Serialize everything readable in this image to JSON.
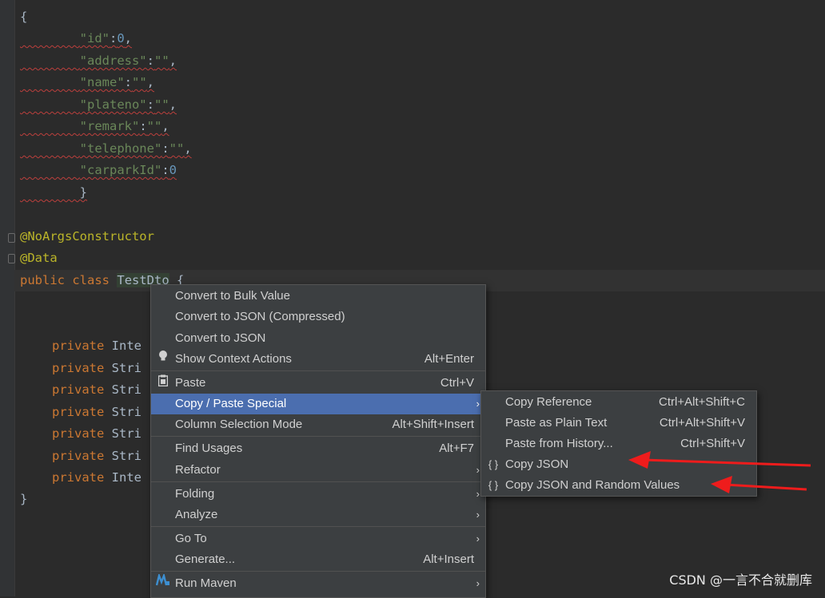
{
  "editor": {
    "lines": [
      {
        "t": "{"
      },
      {
        "k": "        ",
        "s": "\"id\"",
        "p": ":",
        "n": "0",
        "e": ","
      },
      {
        "k": "        ",
        "s": "\"address\"",
        "p": ":",
        "v": "\"\"",
        "e": ","
      },
      {
        "k": "        ",
        "s": "\"name\"",
        "p": ":",
        "v": "\"\"",
        "e": ","
      },
      {
        "k": "        ",
        "s": "\"plateno\"",
        "p": ":",
        "v": "\"\"",
        "e": ","
      },
      {
        "k": "        ",
        "s": "\"remark\"",
        "p": ":",
        "v": "\"\"",
        "e": ","
      },
      {
        "k": "        ",
        "s": "\"telephone\"",
        "p": ":",
        "v": "\"\"",
        "e": ","
      },
      {
        "k": "        ",
        "s": "\"carparkId\"",
        "p": ":",
        "n": "0",
        "e": ""
      },
      {
        "t": "        }"
      }
    ],
    "annotation1": "@NoArgsConstructor",
    "annotation2": "@Data",
    "class_kw1": "public",
    "class_kw2": "class",
    "class_name": "TestDto",
    "class_brace": "{",
    "fields": [
      {
        "kw": "private",
        "type": "Inte"
      },
      {
        "kw": "private",
        "type": "Stri"
      },
      {
        "kw": "private",
        "type": "Stri"
      },
      {
        "kw": "private",
        "type": "Stri"
      },
      {
        "kw": "private",
        "type": "Stri"
      },
      {
        "kw": "private",
        "type": "Stri"
      },
      {
        "kw": "private",
        "type": "Inte"
      }
    ],
    "closing_brace": "}"
  },
  "context_menu": {
    "items": [
      {
        "label": "Convert to Bulk Value",
        "shortcut": "",
        "arrow": ""
      },
      {
        "label": "Convert to JSON (Compressed)",
        "shortcut": "",
        "arrow": ""
      },
      {
        "label": "Convert to JSON",
        "shortcut": "",
        "arrow": ""
      },
      {
        "label": "Show Context Actions",
        "shortcut": "Alt+Enter",
        "arrow": "",
        "icon": "lightbulb-icon"
      },
      {
        "label": "Paste",
        "shortcut": "Ctrl+V",
        "arrow": "",
        "icon": "clipboard-icon"
      },
      {
        "label": "Copy / Paste Special",
        "shortcut": "",
        "arrow": "›"
      },
      {
        "label": "Column Selection Mode",
        "shortcut": "Alt+Shift+Insert",
        "arrow": ""
      },
      {
        "label": "Find Usages",
        "shortcut": "Alt+F7",
        "arrow": ""
      },
      {
        "label": "Refactor",
        "shortcut": "",
        "arrow": "›"
      },
      {
        "label": "Folding",
        "shortcut": "",
        "arrow": "›"
      },
      {
        "label": "Analyze",
        "shortcut": "",
        "arrow": "›"
      },
      {
        "label": "Go To",
        "shortcut": "",
        "arrow": "›"
      },
      {
        "label": "Generate...",
        "shortcut": "Alt+Insert",
        "arrow": ""
      },
      {
        "label": "Run Maven",
        "shortcut": "",
        "arrow": "›",
        "icon": "maven-icon"
      }
    ]
  },
  "submenu": {
    "items": [
      {
        "label": "Copy Reference",
        "shortcut": "Ctrl+Alt+Shift+C",
        "icon": ""
      },
      {
        "label": "Paste as Plain Text",
        "shortcut": "Ctrl+Alt+Shift+V",
        "icon": ""
      },
      {
        "label": "Paste from History...",
        "shortcut": "Ctrl+Shift+V",
        "icon": ""
      },
      {
        "label": "Copy JSON",
        "shortcut": "",
        "icon": "{ }"
      },
      {
        "label": "Copy JSON and Random Values",
        "shortcut": "",
        "icon": "{ }"
      }
    ]
  },
  "colors": {
    "background": "#2b2b2b",
    "menu_bg": "#3c3f41",
    "selection": "#4b6eaf",
    "annotation_arrow": "#ee1c1c"
  },
  "watermark": "CSDN @一言不合就删库"
}
